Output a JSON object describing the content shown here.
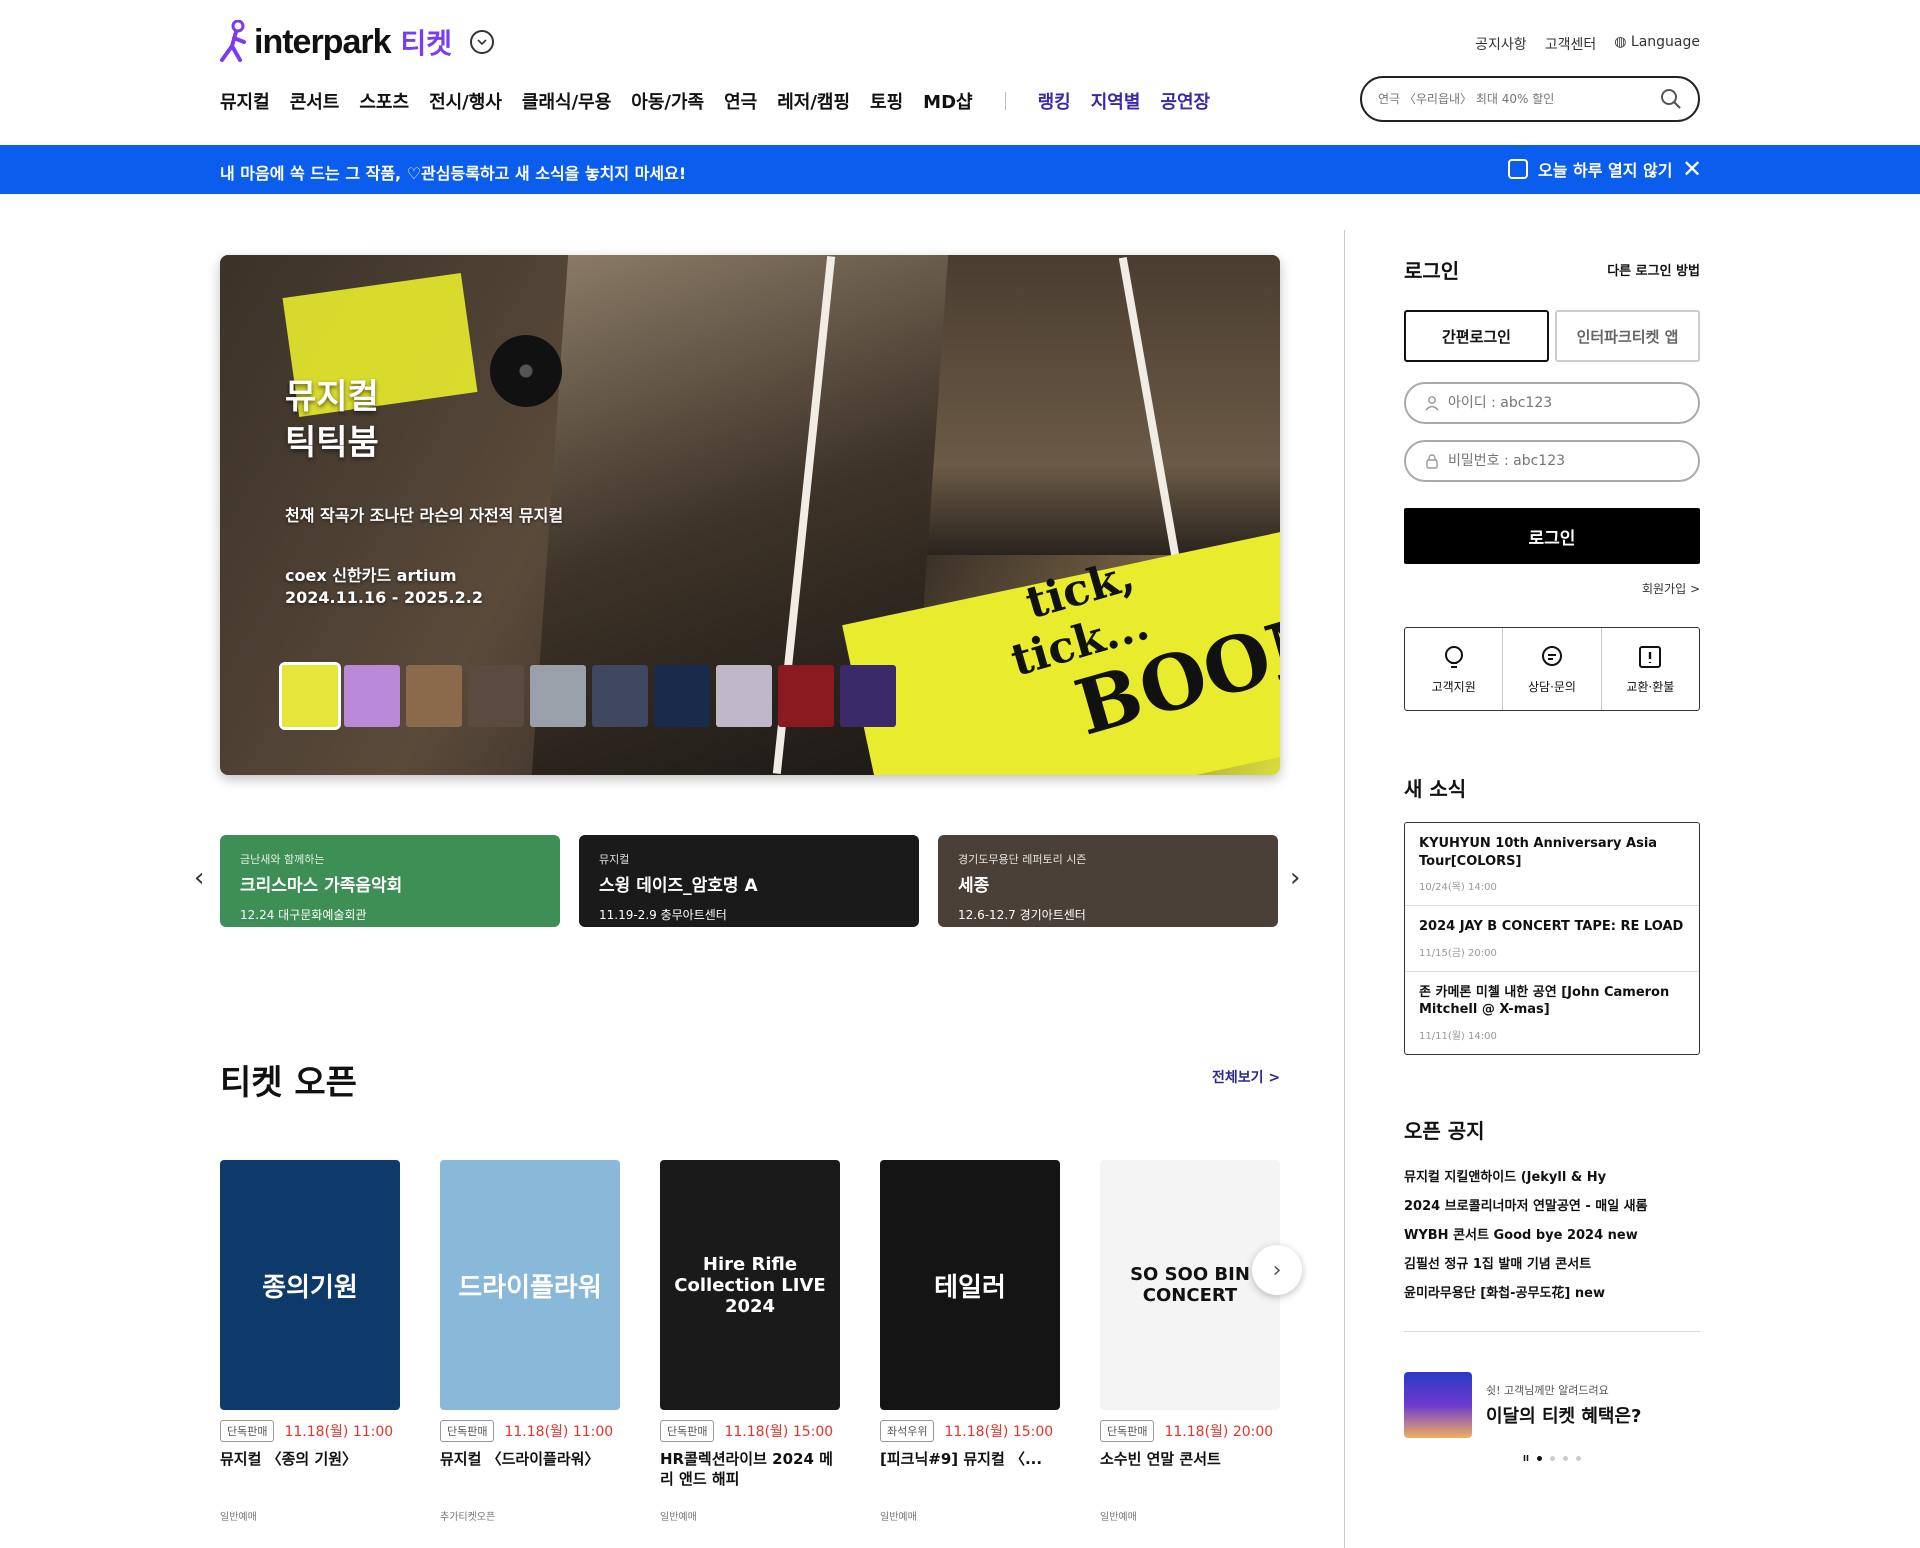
{
  "header": {
    "logo_text": "interpark",
    "logo_sub": "티켓",
    "top_links": [
      "공지사항",
      "고객센터",
      "Language"
    ],
    "nav": [
      "뮤지컬",
      "콘서트",
      "스포츠",
      "전시/행사",
      "클래식/무용",
      "아동/가족",
      "연극",
      "레저/캠핑",
      "토핑",
      "MD샵"
    ],
    "nav_extra": [
      "랭킹",
      "지역별",
      "공연장"
    ],
    "search_placeholder": "연극 〈우리읍내〉 최대 40% 할인"
  },
  "notice": {
    "text": "내 마음에 쏙 드는 그 작품, ♡관심등록하고 새 소식을 놓치지 마세요!",
    "hide_today": "오늘 하루 열지 않기",
    "close": "✕"
  },
  "hero": {
    "title_line1": "뮤지컬",
    "title_line2": "틱틱붐",
    "subtitle": "천재 작곡가 조나단 라슨의 자전적 뮤지컬",
    "venue": "coex 신한카드 artium",
    "dates": "2024.11.16 - 2025.2.2",
    "logo_l1": "tick,",
    "logo_l2": "tick...",
    "logo_l3": "BOOM",
    "thumb_colors": [
      "#e6e63a",
      "#b88ad8",
      "#8a6a4a",
      "#5a4a40",
      "#9aa0aa",
      "#404860",
      "#1a2a4a",
      "#c0b8c8",
      "#8a1a20",
      "#3a2a6a"
    ]
  },
  "promos": [
    {
      "pre": "금난새와 함께하는",
      "title": "크리스마스 가족음악회",
      "date": "12.24 대구문화예술회관",
      "color": "#3d8f55"
    },
    {
      "pre": "뮤지컬",
      "title": "스윙 데이즈_암호명 A",
      "date": "11.19-2.9 충무아트센터",
      "color": "#1a1a1a"
    },
    {
      "pre": "경기도무용단 레퍼토리 시즌",
      "title": "세종",
      "date": "12.6-12.7 경기아트센터",
      "color": "#4a4038"
    }
  ],
  "ticket_open": {
    "title": "티켓 오픈",
    "see_all": "전체보기 >",
    "cards": [
      {
        "poster_text": "종의기원",
        "poster_color": "#0d3a6a",
        "badge": "단독판매",
        "date": "11.18(월) 11:00",
        "title": "뮤지컬 〈종의 기원〉",
        "type": "일반예매"
      },
      {
        "poster_text": "드라이플라워",
        "poster_color": "#8ab8d8",
        "badge": "단독판매",
        "date": "11.18(월) 11:00",
        "title": "뮤지컬 〈드라이플라워〉",
        "type": "추가티켓오픈"
      },
      {
        "poster_text": "Hire Rifle Collection LIVE 2024",
        "poster_color": "#1a1a1a",
        "badge": "단독판매",
        "date": "11.18(월) 15:00",
        "title": "HR콜렉션라이브 2024 메리 앤드 해피",
        "type": "일반예매"
      },
      {
        "poster_text": "테일러",
        "poster_color": "#141414",
        "badge": "좌석우위",
        "date": "11.18(월) 15:00",
        "title": "[피크닉#9] 뮤지컬 〈...",
        "type": "일반예매"
      },
      {
        "poster_text": "SO SOO BIN CONCERT",
        "poster_color": "#f4f4f4",
        "badge": "단독판매",
        "date": "11.18(월) 20:00",
        "title": "소수빈 연말 콘서트",
        "type": "일반예매"
      }
    ]
  },
  "login": {
    "title": "로그인",
    "other": "다른 로그인 방법",
    "tab_easy": "간편로그인",
    "tab_app": "인터파크티켓 앱",
    "id_placeholder": "아이디 : abc123",
    "pw_placeholder": "비밀번호 : abc123",
    "button": "로그인",
    "signup": "회원가입 >",
    "support": [
      "고객지원",
      "상담·문의",
      "교환·환불"
    ]
  },
  "news": {
    "title": "새 소식",
    "items": [
      {
        "title": "KYUHYUN 10th Anniversary Asia Tour[COLORS]",
        "date": "10/24(목) 14:00"
      },
      {
        "title": "2024 JAY B CONCERT TAPE: RE LOAD",
        "date": "11/15(금) 20:00"
      },
      {
        "title": "존 카메론 미첼 내한 공연 [John Cameron Mitchell @ X-mas]",
        "date": "11/11(월) 14:00"
      }
    ]
  },
  "open_notice": {
    "title": "오픈 공지",
    "items": [
      "뮤지컬 지킬앤하이드 (Jekyll & Hy",
      "2024 브로콜리너마저 연말공연 - 매일 새롬",
      "WYBH 콘서트 Good bye 2024 new",
      "김필선 정규 1집 발매 기념 콘서트",
      "윤미라무용단 [화첩-공무도花] new"
    ]
  },
  "side_promo": {
    "pre": "쉿! 고객님께만 알려드려요",
    "title": "이달의 티켓 혜택은?",
    "pause": "II"
  }
}
